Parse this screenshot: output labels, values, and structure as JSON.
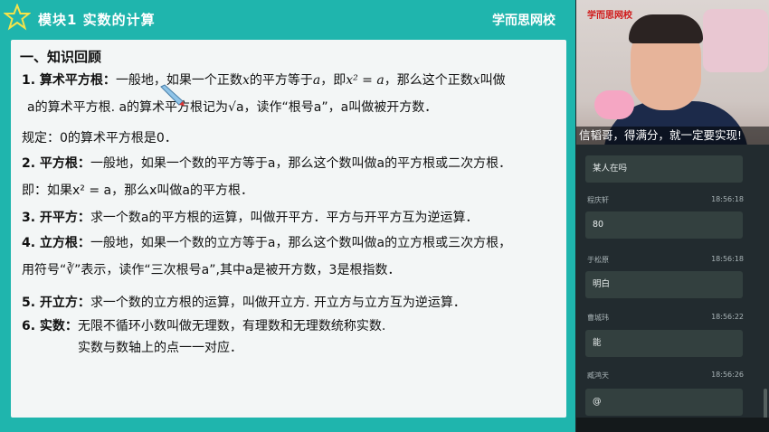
{
  "header": {
    "module_title": "模块1  实数的计算",
    "brand": "学而思网校"
  },
  "content": {
    "section_title": "一、知识回顾",
    "l1a_label": "1. 算术平方根：",
    "l1a_text": "一般地，如果一个正数",
    "l1a_x": "x",
    "l1a_text2": "的平方等于",
    "l1a_a": "a",
    "l1a_text3": "，即",
    "l1a_eq": "x² = a",
    "l1a_text4": "，那么这个正数",
    "l1a_x2": "x",
    "l1a_text5": "叫做",
    "l1b": "a的算术平方根. a的算术平方根记为√a，读作“根号a”，a叫做被开方数．",
    "l1c": "规定：0的算术平方根是0．",
    "l2a_label": "2. 平方根：",
    "l2a_text": "一般地，如果一个数的平方等于a，那么这个数叫做a的平方根或二次方根．",
    "l2b": "即：如果x² = a，那么x叫做a的平方根．",
    "l3_label": "3. 开平方：",
    "l3_text": "求一个数a的平方根的运算，叫做开平方．平方与开平方互为逆运算．",
    "l4a_label": "4. 立方根：",
    "l4a_text": "一般地，如果一个数的立方等于a，那么这个数叫做a的立方根或三次方根，",
    "l4b": "用符号“∛”表示，读作“三次根号a”,其中a是被开方数，3是根指数．",
    "l5_label": "5. 开立方：",
    "l5_text": "求一个数的立方根的运算，叫做开立方. 开立方与立方互为逆运算．",
    "l6a_label": "6. 实数：",
    "l6a_text": "无限不循环小数叫做无理数，有理数和无理数统称实数.",
    "l6b": "实数与数轴上的点一一对应．"
  },
  "video": {
    "logo": "学而思网校",
    "banner": "信韬哥，得满分，就一定要实现!"
  },
  "chat": {
    "messages": [
      {
        "name": "",
        "time": "",
        "text": "某人在吗"
      },
      {
        "name": "程庆轩",
        "time": "18:56:18",
        "text": "80"
      },
      {
        "name": "于松原",
        "time": "18:56:18",
        "text": "明白"
      },
      {
        "name": "曹城玮",
        "time": "18:56:22",
        "text": "能"
      },
      {
        "name": "臧鸿天",
        "time": "18:56:26",
        "text": "@"
      }
    ]
  },
  "colors": {
    "slide_bg": "#1fb5ad",
    "content_bg": "#f3f6f6",
    "chat_bg": "#222b2f",
    "bubble_bg": "#33403f"
  }
}
